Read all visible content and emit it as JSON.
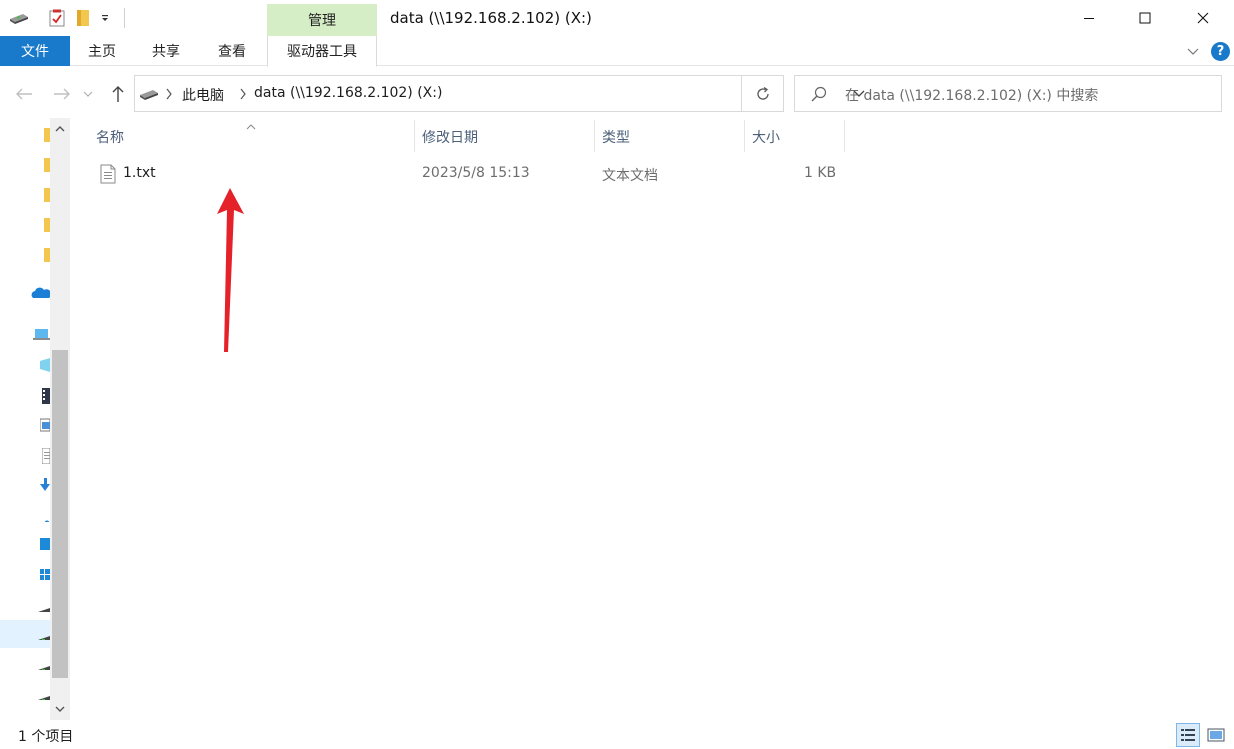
{
  "window": {
    "title": "data (\\\\192.168.2.102) (X:)",
    "context_tab": "管理",
    "controls": {
      "minimize": "—",
      "maximize": "☐",
      "close": "✕"
    }
  },
  "ribbon": {
    "tabs": [
      "文件",
      "主页",
      "共享",
      "查看",
      "驱动器工具"
    ],
    "help": "?"
  },
  "address_bar": {
    "crumbs": [
      "此电脑",
      "data (\\\\192.168.2.102) (X:)"
    ],
    "search_placeholder": "在 data (\\\\192.168.2.102) (X:) 中搜索"
  },
  "file_list": {
    "columns": [
      "名称",
      "修改日期",
      "类型",
      "大小"
    ],
    "rows": [
      {
        "name": "1.txt",
        "modified": "2023/5/8 15:13",
        "type": "文本文档",
        "size": "1 KB"
      }
    ]
  },
  "status_bar": {
    "item_count": "1 个项目"
  },
  "icons": {
    "quick_access": [
      "network-drive-icon",
      "properties-check-icon",
      "folder-icon",
      "customize-dropdown-icon"
    ],
    "nav": [
      "back-arrow-icon",
      "forward-arrow-icon",
      "recent-dropdown-icon",
      "up-arrow-icon",
      "network-drive-icon",
      "refresh-icon",
      "search-icon"
    ],
    "file": "text-file-icon",
    "annotation": "red-arrow-icon"
  },
  "colors": {
    "accent": "#1979ca",
    "manage_tab": "#d6eec6",
    "annotation_arrow": "#e5212a",
    "header_text": "#4c607a"
  }
}
